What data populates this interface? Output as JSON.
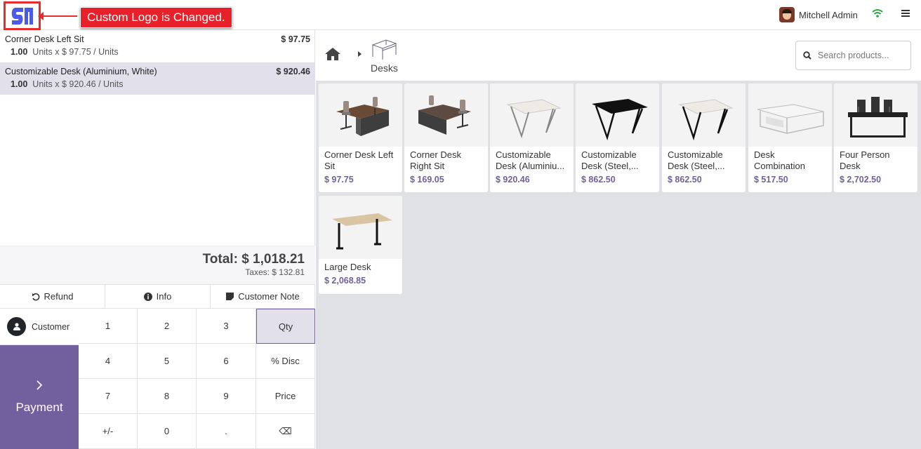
{
  "annotation": {
    "callout": "Custom Logo is Changed."
  },
  "user": {
    "name": "Mitchell Admin"
  },
  "order": {
    "lines": [
      {
        "name": "Corner Desk Left Sit",
        "price": "$ 97.75",
        "qty": "1.00",
        "detail": "Units x $ 97.75 / Units"
      },
      {
        "name": "Customizable Desk (Aluminium, White)",
        "price": "$ 920.46",
        "qty": "1.00",
        "detail": "Units x $ 920.46 / Units"
      }
    ],
    "total": "Total: $ 1,018.21",
    "taxes": "Taxes: $ 132.81"
  },
  "controls": {
    "refund": "Refund",
    "info": "Info",
    "note": "Customer Note"
  },
  "customer": "Customer",
  "payment": "Payment",
  "numpad": [
    "1",
    "2",
    "3",
    "Qty",
    "4",
    "5",
    "6",
    "% Disc",
    "7",
    "8",
    "9",
    "Price",
    "+/-",
    "0",
    ".",
    "⌫"
  ],
  "breadcrumb": {
    "category": "Desks"
  },
  "search": {
    "placeholder": "Search products..."
  },
  "products": [
    {
      "name": "Corner Desk Left Sit",
      "price": "$ 97.75"
    },
    {
      "name": "Corner Desk Right Sit",
      "price": "$ 169.05"
    },
    {
      "name": "Customizable Desk (Aluminiu...",
      "price": "$ 920.46"
    },
    {
      "name": "Customizable Desk (Steel,...",
      "price": "$ 862.50"
    },
    {
      "name": "Customizable Desk (Steel,...",
      "price": "$ 862.50"
    },
    {
      "name": "Desk Combination",
      "price": "$ 517.50"
    },
    {
      "name": "Four Person Desk",
      "price": "$ 2,702.50"
    },
    {
      "name": "Large Desk",
      "price": "$ 2,068.85"
    }
  ],
  "colors": {
    "accent": "#715f9e",
    "annotation": "#e8202a",
    "logo": "#4a5be8"
  }
}
